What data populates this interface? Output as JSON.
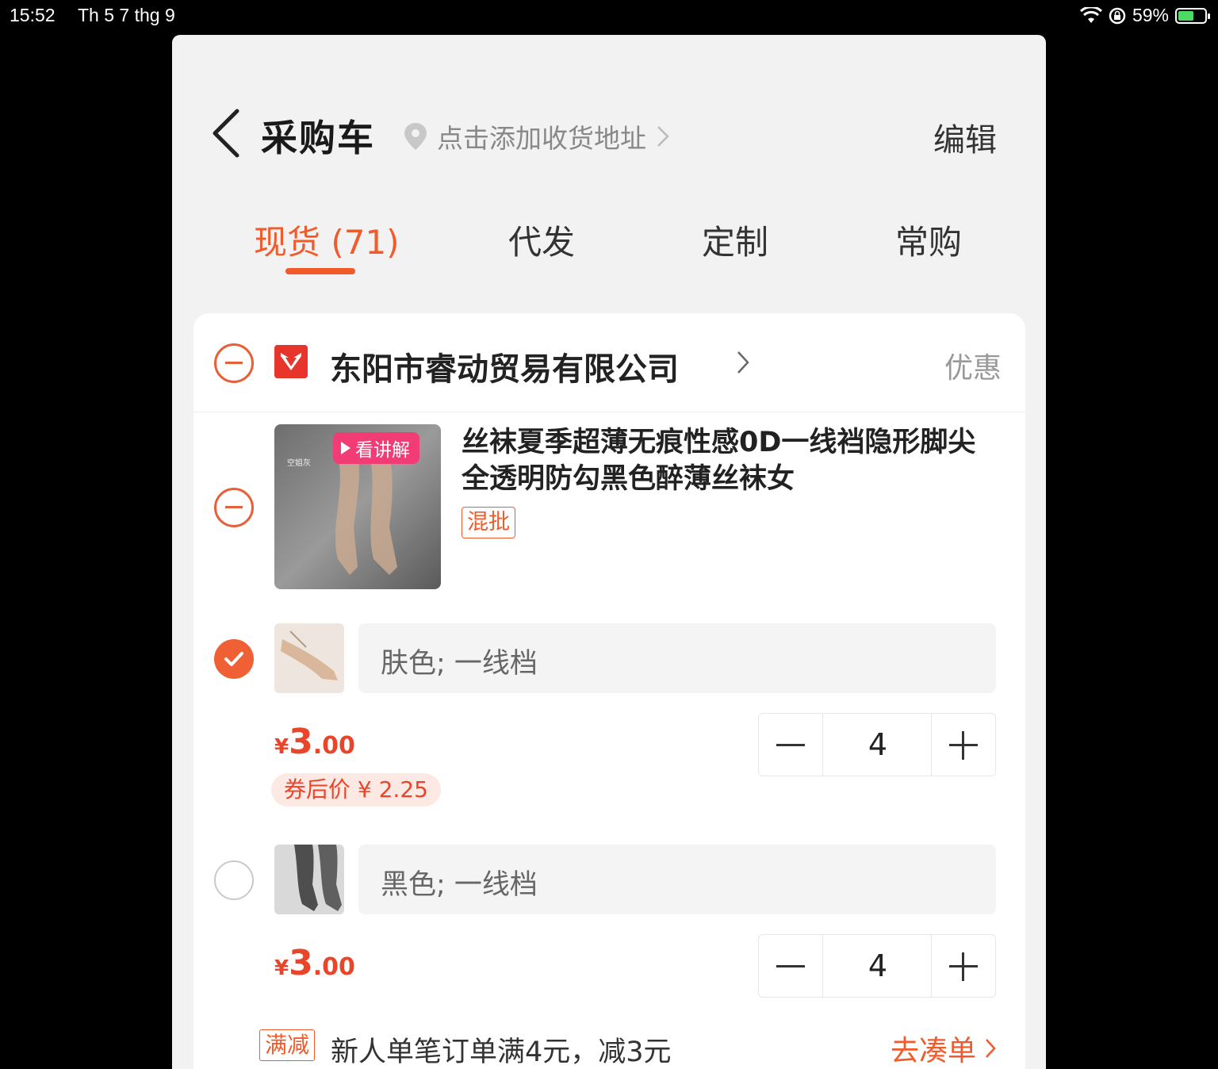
{
  "status_bar": {
    "time": "15:52",
    "date": "Th 5 7 thg 9",
    "battery": "59%",
    "battery_level": 0.59
  },
  "header": {
    "title": "采购车",
    "address": "点击添加收货地址",
    "edit": "编辑"
  },
  "tabs": [
    {
      "label": "现货 (71)",
      "active": true
    },
    {
      "label": "代发"
    },
    {
      "label": "定制"
    },
    {
      "label": "常购"
    }
  ],
  "shop": {
    "name": "东阳市睿动贸易有限公司",
    "promo": "优惠"
  },
  "product": {
    "title": "丝袜夏季超薄无痕性感0D一线裆隐形脚尖全透明防勾黑色醉薄丝袜女",
    "video_badge": "看讲解",
    "tag": "混批",
    "image_caption": "空姐灰"
  },
  "skus": [
    {
      "label": "肤色; 一线档",
      "checked": true,
      "price_yen": "¥",
      "price_int": "3",
      "price_dec": ".00",
      "qty": "4",
      "coupon": "券后价 ¥ 2.25"
    },
    {
      "label": "黑色; 一线档",
      "checked": false,
      "price_yen": "¥",
      "price_int": "3",
      "price_dec": ".00",
      "qty": "4"
    }
  ],
  "promotion": {
    "tag": "满减",
    "text": "新人单笔订单满4元，减3元",
    "link": "去凑单"
  },
  "colors": {
    "accent": "#f15a2b",
    "price": "#e8452a",
    "panel_bg": "#f2f2f2"
  }
}
